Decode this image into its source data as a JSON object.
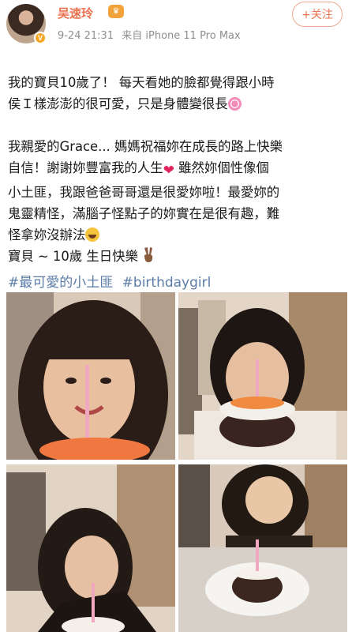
{
  "user": {
    "name": "吴速玲",
    "badge": "V",
    "vip_glyph": "♛",
    "date": "9-24 21:31",
    "source": "来自 iPhone 11 Pro Max",
    "follow_label": "+关注"
  },
  "post": {
    "para1_line1": "我的寶貝10歲了！ 每天看她的臉都覺得跟小時",
    "para1_line2": "侯Ｉ樣澎澎的很可愛，只是身體變很長",
    "para2_line1": "我親愛的Grace... 媽媽祝福妳在成長的路上快樂",
    "para2_line2a": "自信！謝謝妳豐富我的人生",
    "para2_line2b": " 雖然妳個性像個",
    "para2_line3": "小土匪，我跟爸爸哥哥還是很愛妳啦！最愛妳的",
    "para2_line4": "鬼靈精怪，滿腦子怪點子的妳實在是很有趣，難",
    "para2_line5": "怪拿妳沒辦法",
    "para2_line6": "寶貝 ~ 10歲 生日快樂",
    "heart_glyph": "❤"
  },
  "hashtags": [
    "#最可愛的小土匪",
    "#birthdaygirl"
  ],
  "photos": [
    {
      "icon": "girl-with-candle-photo"
    },
    {
      "icon": "girl-blowing-cake-photo"
    },
    {
      "icon": "girl-leaning-cake-photo"
    },
    {
      "icon": "girl-and-cake-photo"
    }
  ],
  "colors": {
    "username": "#eb7350",
    "hashtag": "#5b7ca8",
    "meta": "#8f8f8f",
    "follow_border": "#f0a98f"
  }
}
